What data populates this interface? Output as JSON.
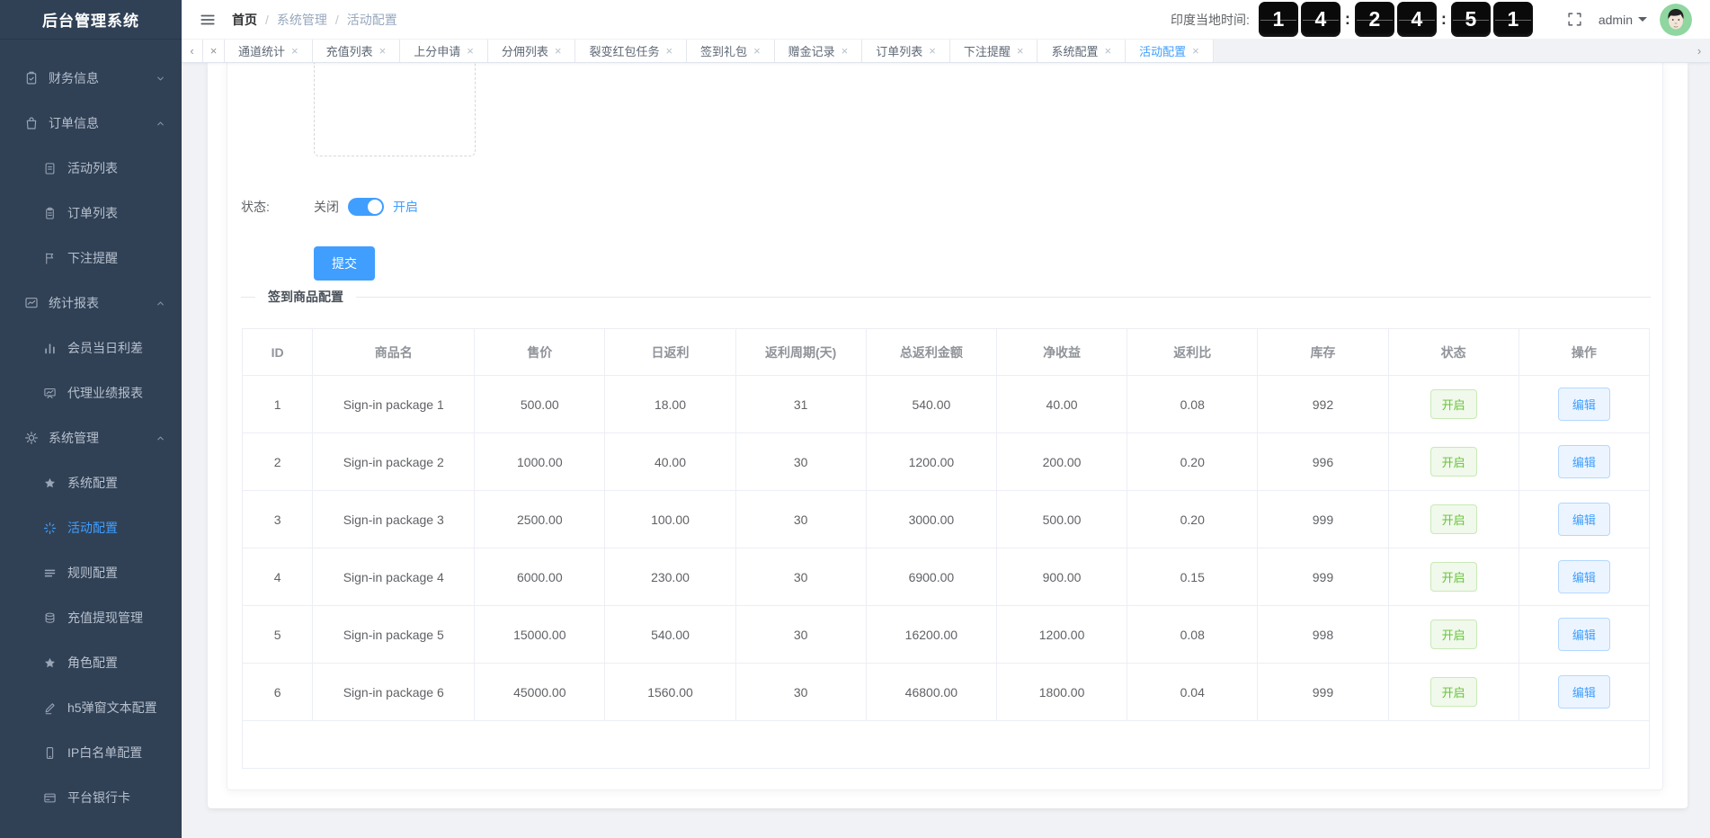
{
  "app": {
    "title": "后台管理系统"
  },
  "sidebar": {
    "groups": [
      {
        "label": "财务信息",
        "icon": "clipboard-check-icon",
        "expanded": false,
        "children": []
      },
      {
        "label": "订单信息",
        "icon": "bag-icon",
        "expanded": true,
        "children": [
          {
            "label": "活动列表",
            "icon": "document-icon"
          },
          {
            "label": "订单列表",
            "icon": "clipboard-icon"
          },
          {
            "label": "下注提醒",
            "icon": "flag-icon"
          }
        ]
      },
      {
        "label": "统计报表",
        "icon": "line-chart-icon",
        "expanded": true,
        "children": [
          {
            "label": "会员当日利差",
            "icon": "bar-chart-icon"
          },
          {
            "label": "代理业绩报表",
            "icon": "presentation-icon"
          }
        ]
      },
      {
        "label": "系统管理",
        "icon": "gear-icon",
        "expanded": true,
        "children": [
          {
            "label": "系统配置",
            "icon": "star-icon"
          },
          {
            "label": "活动配置",
            "icon": "burst-icon",
            "active": true
          },
          {
            "label": "规则配置",
            "icon": "list-icon"
          },
          {
            "label": "充值提现管理",
            "icon": "database-icon"
          },
          {
            "label": "角色配置",
            "icon": "star-icon"
          },
          {
            "label": "h5弹窗文本配置",
            "icon": "pencil-icon"
          },
          {
            "label": "IP白名单配置",
            "icon": "phone-icon"
          },
          {
            "label": "平台银行卡",
            "icon": "bank-card-icon"
          }
        ]
      }
    ]
  },
  "header": {
    "breadcrumb": [
      "首页",
      "系统管理",
      "活动配置"
    ],
    "separator": "/",
    "clock_label": "印度当地时间:",
    "clock_digits": [
      "1",
      "4",
      "2",
      "4",
      "5",
      "1"
    ],
    "colon": ":",
    "username": "admin"
  },
  "tabs": {
    "prev": "‹",
    "next": "›",
    "close_all": "×",
    "close": "×",
    "items": [
      {
        "label": "通道统计"
      },
      {
        "label": "充值列表"
      },
      {
        "label": "上分申请"
      },
      {
        "label": "分佣列表"
      },
      {
        "label": "裂变红包任务"
      },
      {
        "label": "签到礼包"
      },
      {
        "label": "赠金记录"
      },
      {
        "label": "订单列表"
      },
      {
        "label": "下注提醒"
      },
      {
        "label": "系统配置"
      },
      {
        "label": "活动配置",
        "active": true
      }
    ]
  },
  "form": {
    "status_label": "状态:",
    "off_label": "关闭",
    "on_label": "开启",
    "toggle_on": true,
    "submit_label": "提交"
  },
  "section": {
    "title": "签到商品配置"
  },
  "table": {
    "columns": [
      "ID",
      "商品名",
      "售价",
      "日返利",
      "返利周期(天)",
      "总返利金额",
      "净收益",
      "返利比",
      "库存",
      "状态",
      "操作"
    ],
    "rows": [
      {
        "id": "1",
        "name": "Sign-in package 1",
        "price": "500.00",
        "daily": "18.00",
        "period": "31",
        "total": "540.00",
        "net": "40.00",
        "ratio": "0.08",
        "stock": "992",
        "status": "开启",
        "action": "编辑"
      },
      {
        "id": "2",
        "name": "Sign-in package 2",
        "price": "1000.00",
        "daily": "40.00",
        "period": "30",
        "total": "1200.00",
        "net": "200.00",
        "ratio": "0.20",
        "stock": "996",
        "status": "开启",
        "action": "编辑"
      },
      {
        "id": "3",
        "name": "Sign-in package 3",
        "price": "2500.00",
        "daily": "100.00",
        "period": "30",
        "total": "3000.00",
        "net": "500.00",
        "ratio": "0.20",
        "stock": "999",
        "status": "开启",
        "action": "编辑"
      },
      {
        "id": "4",
        "name": "Sign-in package 4",
        "price": "6000.00",
        "daily": "230.00",
        "period": "30",
        "total": "6900.00",
        "net": "900.00",
        "ratio": "0.15",
        "stock": "999",
        "status": "开启",
        "action": "编辑"
      },
      {
        "id": "5",
        "name": "Sign-in package 5",
        "price": "15000.00",
        "daily": "540.00",
        "period": "30",
        "total": "16200.00",
        "net": "1200.00",
        "ratio": "0.08",
        "stock": "998",
        "status": "开启",
        "action": "编辑"
      },
      {
        "id": "6",
        "name": "Sign-in package 6",
        "price": "45000.00",
        "daily": "1560.00",
        "period": "30",
        "total": "46800.00",
        "net": "1800.00",
        "ratio": "0.04",
        "stock": "999",
        "status": "开启",
        "action": "编辑"
      }
    ]
  },
  "colors": {
    "accent": "#409eff",
    "sidebar_bg": "#304156",
    "page_bg": "#f0f2f5",
    "success_text": "#67c23a",
    "success_bg": "#f0f9eb",
    "clock_bg": "#0a0a0a",
    "avatar_bg": "#8fd6a0"
  }
}
